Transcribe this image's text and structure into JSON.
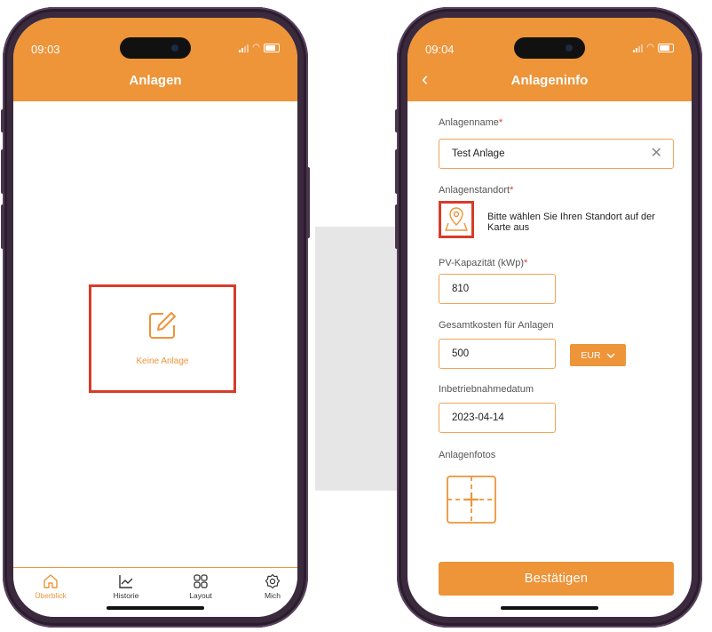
{
  "colors": {
    "accent": "#ee9439",
    "highlight": "#d83b2a",
    "required": "#e43a2a"
  },
  "left_phone": {
    "status_time": "09:03",
    "header_title": "Anlagen",
    "empty_state": {
      "icon": "edit-icon",
      "text": "Keine Anlage"
    },
    "tabs": [
      {
        "label": "Überblick",
        "icon": "home-icon",
        "active": true
      },
      {
        "label": "Historie",
        "icon": "chart-icon",
        "active": false
      },
      {
        "label": "Layout",
        "icon": "grid-icon",
        "active": false
      },
      {
        "label": "Mich",
        "icon": "gear-icon",
        "active": false
      }
    ]
  },
  "right_phone": {
    "status_time": "09:04",
    "header_title": "Anlageninfo",
    "back_icon": "chevron-left-icon",
    "form": {
      "name_label": "Anlagenname",
      "name_value": "Test Anlage",
      "location_label": "Anlagenstandort",
      "location_hint": "Bitte wählen Sie Ihren Standort auf der Karte aus",
      "capacity_label": "PV-Kapazität (kWp)",
      "capacity_value": "810",
      "cost_label": "Gesamtkosten für Anlagen",
      "cost_value": "500",
      "currency": "EUR",
      "date_label": "Inbetriebnahmedatum",
      "date_value": "2023-04-14",
      "photos_label": "Anlagenfotos",
      "required_mark": "*"
    },
    "confirm_label": "Bestätigen"
  }
}
